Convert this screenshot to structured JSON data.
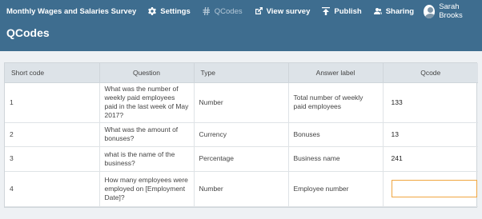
{
  "header": {
    "survey_title": "Monthly Wages and Salaries Survey",
    "page_title": "QCodes",
    "background": "#3e6d8f",
    "nav": [
      {
        "label": "Settings",
        "icon": "gear-icon"
      },
      {
        "label": "QCodes",
        "icon": "hash-icon"
      },
      {
        "label": "View survey",
        "icon": "external-link-icon"
      },
      {
        "label": "Publish",
        "icon": "upload-icon"
      },
      {
        "label": "Sharing",
        "icon": "users-icon"
      }
    ],
    "user": {
      "name": "Sarah Brooks",
      "icon": "avatar-icon"
    }
  },
  "table": {
    "columns": [
      "Short code",
      "Question",
      "Type",
      "Answer label",
      "Qcode"
    ],
    "rows": [
      {
        "short_code": "1",
        "question": "What was the number of weekly paid employees paid in the last week of May 2017?",
        "type": "Number",
        "answer_label": "Total number of weekly paid employees",
        "qcode": "133"
      },
      {
        "short_code": "2",
        "question": "What was the amount of bonuses?",
        "type": "Currency",
        "answer_label": "Bonuses",
        "qcode": "13"
      },
      {
        "short_code": "3",
        "question": "what is the name of the business?",
        "type": "Percentage",
        "answer_label": "Business name",
        "qcode": "241"
      },
      {
        "short_code": "4",
        "question": "How many employees were employed on [Employment Date]?",
        "type": "Number",
        "answer_label": "Employee number",
        "qcode": ""
      }
    ]
  },
  "colors": {
    "focus_border": "#f0a640",
    "table_header_bg": "#dde3e8"
  }
}
